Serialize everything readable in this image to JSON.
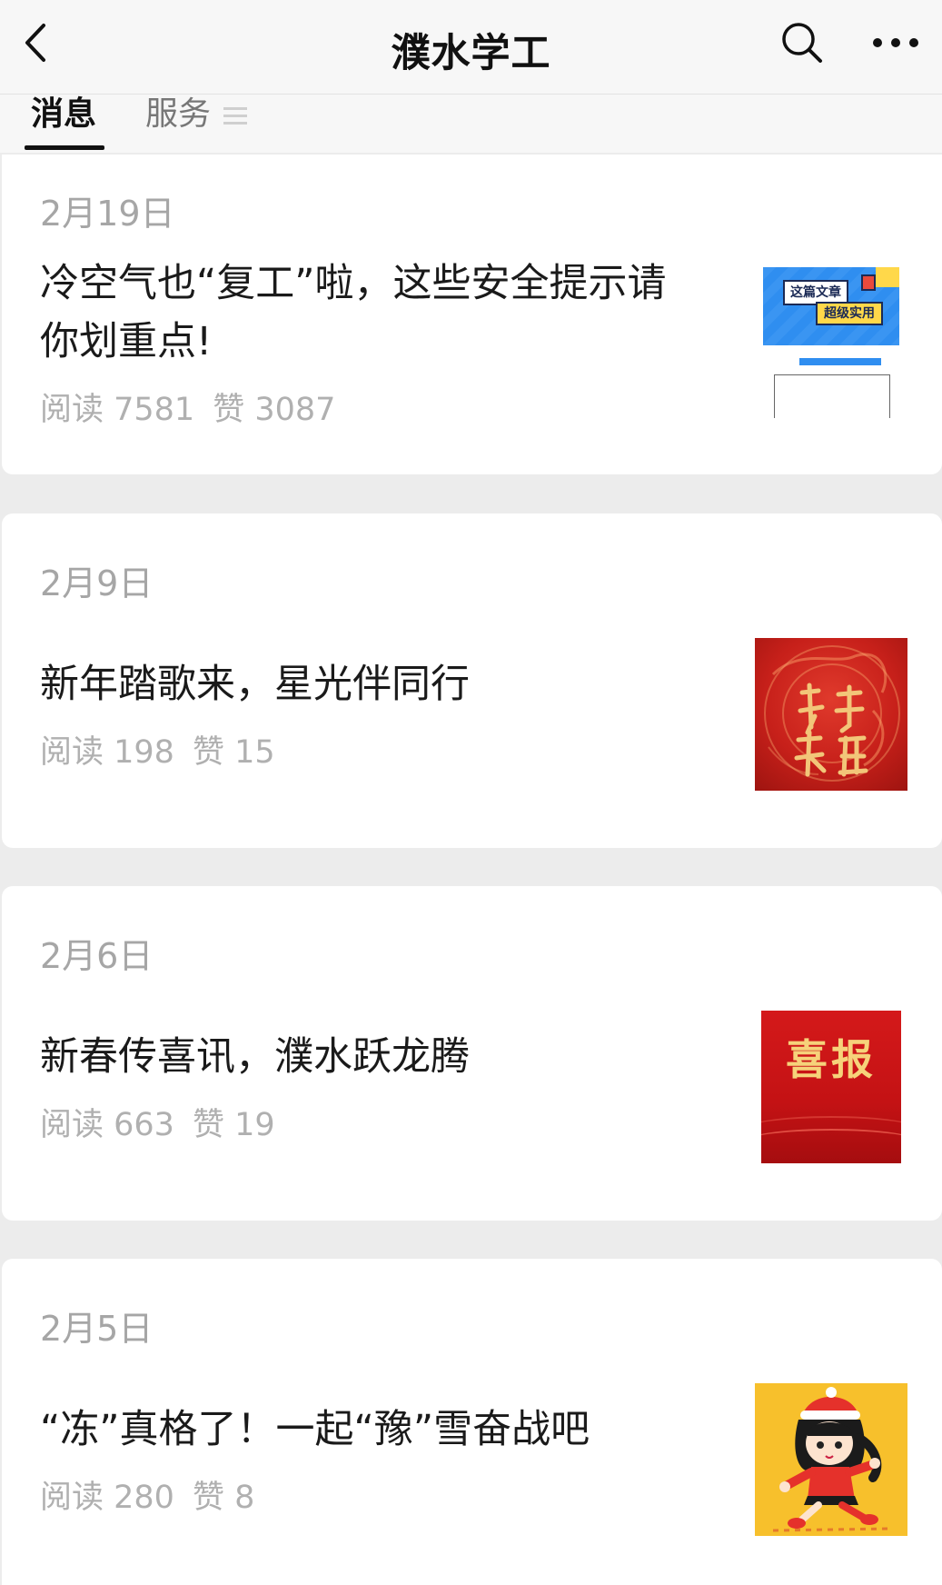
{
  "nav": {
    "title": "濮水学工",
    "back_icon": "chevron-left-icon",
    "search_icon": "search-icon",
    "more_icon": "more-dots-icon"
  },
  "tabs": {
    "messages": "消息",
    "services": "服务",
    "menu_icon": "hamburger-icon"
  },
  "articles": [
    {
      "date": "2月19日",
      "title_line1": "冷空气也“复工”啦，这些安全提示请",
      "title_line2": "你划重点!",
      "reads": "阅读 7581",
      "likes": "赞 3087",
      "thumb_text1": "这篇文章",
      "thumb_text2": "超级实用"
    },
    {
      "date": "2月9日",
      "title": "新年踏歌来，星光伴同行",
      "reads": "阅读 198",
      "likes": "赞 15"
    },
    {
      "date": "2月6日",
      "title": "新春传喜讯，濮水跃龙腾",
      "reads": "阅读 663",
      "likes": "赞 19",
      "thumb_text": "喜报"
    },
    {
      "date": "2月5日",
      "title": "“冻”真格了！一起“豫”雪奋战吧",
      "reads": "阅读 280",
      "likes": "赞 8"
    }
  ],
  "colors": {
    "background": "#ececec",
    "card": "#ffffff",
    "meta_text": "#b0b0b0",
    "title_text": "#1a1a1a"
  }
}
